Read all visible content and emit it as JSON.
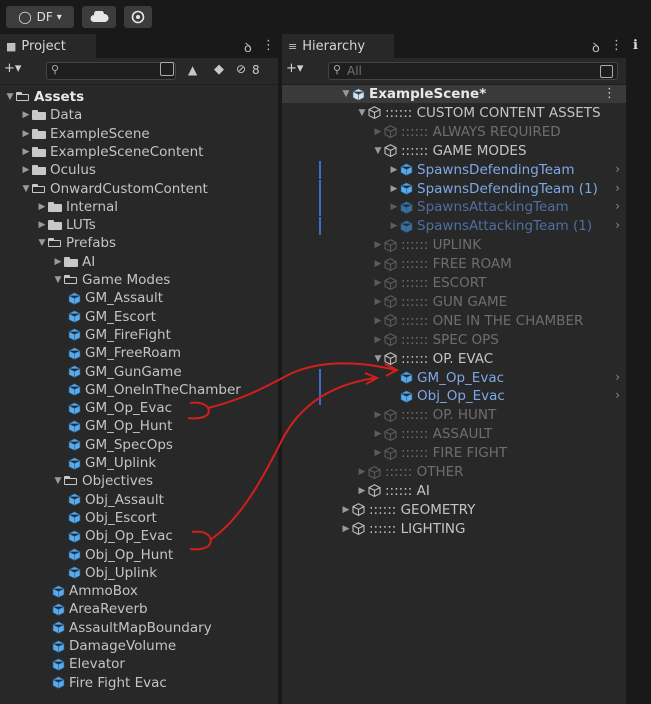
{
  "topbar": {
    "account_label": "DF",
    "account_arrow": "▾",
    "cloud_icon": "cloud-icon",
    "collab_icon": "collab-icon"
  },
  "project": {
    "tab_label": "Project",
    "lock_icon": "ꝺ",
    "menu_icon": "⋮",
    "add_label": "+▾",
    "search_placeholder": "",
    "hidden_count": "8",
    "tree": [
      {
        "label": "Assets",
        "depth": 0,
        "kind": "folder-open",
        "arrow": "▼",
        "bold": true
      },
      {
        "label": "Data",
        "depth": 1,
        "kind": "folder",
        "arrow": "▶"
      },
      {
        "label": "ExampleScene",
        "depth": 1,
        "kind": "folder",
        "arrow": "▶"
      },
      {
        "label": "ExampleSceneContent",
        "depth": 1,
        "kind": "folder",
        "arrow": "▶"
      },
      {
        "label": "Oculus",
        "depth": 1,
        "kind": "folder",
        "arrow": "▶"
      },
      {
        "label": "OnwardCustomContent",
        "depth": 1,
        "kind": "folder-open",
        "arrow": "▼"
      },
      {
        "label": "Internal",
        "depth": 2,
        "kind": "folder",
        "arrow": "▶"
      },
      {
        "label": "LUTs",
        "depth": 2,
        "kind": "folder",
        "arrow": "▶"
      },
      {
        "label": "Prefabs",
        "depth": 2,
        "kind": "folder-open",
        "arrow": "▼"
      },
      {
        "label": "AI",
        "depth": 3,
        "kind": "folder",
        "arrow": "▶"
      },
      {
        "label": "Game Modes",
        "depth": 3,
        "kind": "folder-open",
        "arrow": "▼"
      },
      {
        "label": "GM_Assault",
        "depth": 4,
        "kind": "prefab"
      },
      {
        "label": "GM_Escort",
        "depth": 4,
        "kind": "prefab"
      },
      {
        "label": "GM_FireFight",
        "depth": 4,
        "kind": "prefab"
      },
      {
        "label": "GM_FreeRoam",
        "depth": 4,
        "kind": "prefab"
      },
      {
        "label": "GM_GunGame",
        "depth": 4,
        "kind": "prefab"
      },
      {
        "label": "GM_OneInTheChamber",
        "depth": 4,
        "kind": "prefab"
      },
      {
        "label": "GM_Op_Evac",
        "depth": 4,
        "kind": "prefab"
      },
      {
        "label": "GM_Op_Hunt",
        "depth": 4,
        "kind": "prefab"
      },
      {
        "label": "GM_SpecOps",
        "depth": 4,
        "kind": "prefab"
      },
      {
        "label": "GM_Uplink",
        "depth": 4,
        "kind": "prefab"
      },
      {
        "label": "Objectives",
        "depth": 3,
        "kind": "folder-open",
        "arrow": "▼"
      },
      {
        "label": "Obj_Assault",
        "depth": 4,
        "kind": "prefab"
      },
      {
        "label": "Obj_Escort",
        "depth": 4,
        "kind": "prefab"
      },
      {
        "label": "Obj_Op_Evac",
        "depth": 4,
        "kind": "prefab"
      },
      {
        "label": "Obj_Op_Hunt",
        "depth": 4,
        "kind": "prefab"
      },
      {
        "label": "Obj_Uplink",
        "depth": 4,
        "kind": "prefab"
      },
      {
        "label": "AmmoBox",
        "depth": 3,
        "kind": "prefab"
      },
      {
        "label": "AreaReverb",
        "depth": 3,
        "kind": "prefab"
      },
      {
        "label": "AssaultMapBoundary",
        "depth": 3,
        "kind": "prefab"
      },
      {
        "label": "DamageVolume",
        "depth": 3,
        "kind": "prefab"
      },
      {
        "label": "Elevator",
        "depth": 3,
        "kind": "prefab"
      },
      {
        "label": "Fire Fight Evac",
        "depth": 3,
        "kind": "prefab"
      }
    ]
  },
  "hierarchy": {
    "tab_label": "Hierarchy",
    "lock_icon": "ꝺ",
    "menu_icon": "⋮",
    "add_label": "+▾",
    "search_placeholder": "All",
    "inspector_icon": "ℹ",
    "tree": [
      {
        "label": "ExampleScene*",
        "depth": 0,
        "arrow": "▼",
        "style": "bold",
        "kind": "scene"
      },
      {
        "label": ":::::: CUSTOM CONTENT ASSETS",
        "depth": 1,
        "arrow": "▼",
        "style": "normal",
        "kind": "empty"
      },
      {
        "label": ":::::: ALWAYS REQUIRED",
        "depth": 2,
        "arrow": "▶",
        "style": "dim",
        "kind": "empty"
      },
      {
        "label": ":::::: GAME MODES",
        "depth": 2,
        "arrow": "▼",
        "style": "normal",
        "kind": "empty"
      },
      {
        "label": "SpawnsDefendingTeam",
        "depth": 3,
        "arrow": "▶",
        "style": "blue",
        "kind": "prefab",
        "mark": true,
        "chevron": "›"
      },
      {
        "label": "SpawnsDefendingTeam (1)",
        "depth": 3,
        "arrow": "▶",
        "style": "blue",
        "kind": "prefab",
        "mark": true,
        "chevron": "›"
      },
      {
        "label": "SpawnsAttackingTeam",
        "depth": 3,
        "arrow": "▶",
        "style": "bluedim",
        "kind": "prefab-dim",
        "mark": true,
        "chevron": "›"
      },
      {
        "label": "SpawnsAttackingTeam (1)",
        "depth": 3,
        "arrow": "▶",
        "style": "bluedim",
        "kind": "prefab-dim",
        "mark": true,
        "chevron": "›"
      },
      {
        "label": ":::::: UPLINK",
        "depth": 2,
        "arrow": "▶",
        "style": "dim",
        "kind": "empty"
      },
      {
        "label": ":::::: FREE ROAM",
        "depth": 2,
        "arrow": "▶",
        "style": "dim",
        "kind": "empty"
      },
      {
        "label": ":::::: ESCORT",
        "depth": 2,
        "arrow": "▶",
        "style": "dim",
        "kind": "empty"
      },
      {
        "label": ":::::: GUN GAME",
        "depth": 2,
        "arrow": "▶",
        "style": "dim",
        "kind": "empty"
      },
      {
        "label": ":::::: ONE IN THE CHAMBER",
        "depth": 2,
        "arrow": "▶",
        "style": "dim",
        "kind": "empty"
      },
      {
        "label": ":::::: SPEC OPS",
        "depth": 2,
        "arrow": "▶",
        "style": "dim",
        "kind": "empty"
      },
      {
        "label": ":::::: OP. EVAC",
        "depth": 2,
        "arrow": "▼",
        "style": "normal",
        "kind": "empty"
      },
      {
        "label": "GM_Op_Evac",
        "depth": 3,
        "arrow": "",
        "style": "blue",
        "kind": "prefab",
        "mark": true,
        "chevron": "›"
      },
      {
        "label": "Obj_Op_Evac",
        "depth": 3,
        "arrow": "",
        "style": "blue",
        "kind": "prefab",
        "mark": true,
        "chevron": "›"
      },
      {
        "label": ":::::: OP. HUNT",
        "depth": 2,
        "arrow": "▶",
        "style": "dim",
        "kind": "empty"
      },
      {
        "label": ":::::: ASSAULT",
        "depth": 2,
        "arrow": "▶",
        "style": "dim",
        "kind": "empty"
      },
      {
        "label": ":::::: FIRE FIGHT",
        "depth": 2,
        "arrow": "▶",
        "style": "dim",
        "kind": "empty"
      },
      {
        "label": ":::::: OTHER",
        "depth": 1,
        "arrow": "▶",
        "style": "dim",
        "kind": "empty"
      },
      {
        "label": ":::::: AI",
        "depth": 1,
        "arrow": "▶",
        "style": "normal",
        "kind": "empty"
      },
      {
        "label": ":::::: GEOMETRY",
        "depth": 0,
        "arrow": "▶",
        "style": "normal",
        "kind": "empty"
      },
      {
        "label": ":::::: LIGHTING",
        "depth": 0,
        "arrow": "▶",
        "style": "normal",
        "kind": "empty"
      }
    ]
  },
  "colors": {
    "annotation": "#d0201c",
    "prefab": "#5aa9e8",
    "selection_marker": "#3a6ec9"
  }
}
